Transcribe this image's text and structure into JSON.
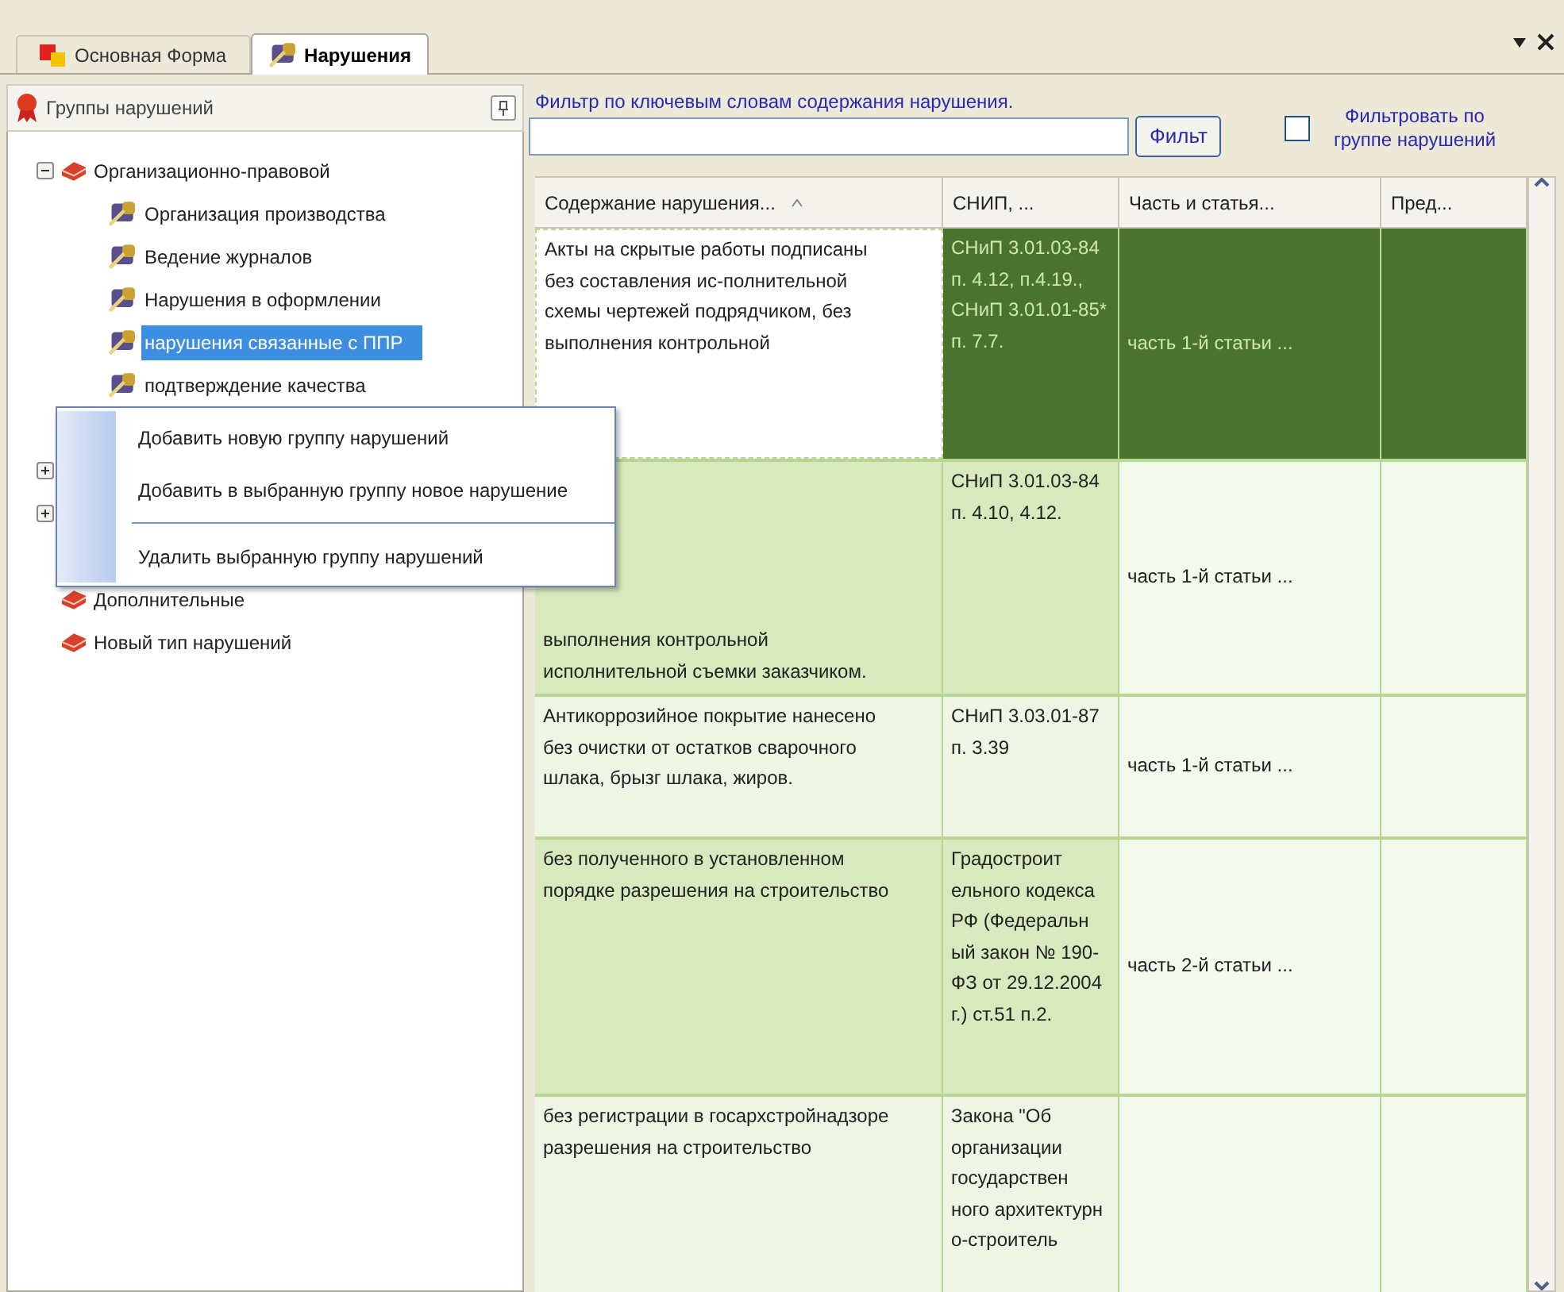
{
  "tabs": [
    {
      "label": "Основная Форма",
      "selected": false
    },
    {
      "label": "Нарушения",
      "selected": true
    }
  ],
  "groups_panel": {
    "title": "Группы нарушений",
    "tree": [
      {
        "label": "Организационно-правовой",
        "kind": "group",
        "expanded": true,
        "children": [
          {
            "label": "Организация производства",
            "kind": "leaf",
            "selected": false
          },
          {
            "label": "Ведение журналов",
            "kind": "leaf",
            "selected": false
          },
          {
            "label": "Нарушения в оформлении",
            "kind": "leaf",
            "selected": false
          },
          {
            "label": "нарушения связанные с ППР",
            "kind": "leaf",
            "selected": true
          },
          {
            "label": "подтверждение качества",
            "kind": "leaf",
            "selected": false
          }
        ]
      },
      {
        "kind": "group",
        "expanded": false
      },
      {
        "kind": "group",
        "expanded": false
      },
      {
        "label": "Дополнительные",
        "kind": "group"
      },
      {
        "label": "Новый тип нарушений",
        "kind": "group"
      }
    ]
  },
  "context_menu": [
    {
      "label": "Добавить новую группу нарушений"
    },
    {
      "label": "Добавить в выбранную группу новое нарушение"
    },
    {
      "kind": "separator"
    },
    {
      "label": "Удалить выбранную группу нарушений"
    }
  ],
  "filter": {
    "label": "Фильтр по ключевым словам содержания нарушения.",
    "button": "Фильт",
    "group_filter": {
      "label": "Фильтровать по группе нарушений",
      "checked": false
    }
  },
  "table": {
    "columns": [
      "Содержание нарушения...",
      "СНИП, ...",
      "Часть и статья...",
      "Пред..."
    ],
    "rows": [
      {
        "selected": true,
        "cells": [
          "Акты на скрытые работы подписаны без составления ис-полнительной схемы чертежей подрядчиком, без выполнения контрольной",
          "СНиП 3.01.03-84 п. 4.12, п.4.19., СНиП 3.01.01-85* п. 7.7.",
          "часть 1-й статьи ..."
        ]
      },
      {
        "selected": false,
        "cells": [
          "выполнения контрольной исполнительной съемки заказчиком.",
          "СНиП 3.01.03-84 п. 4.10, 4.12.",
          "часть 1-й статьи ..."
        ]
      },
      {
        "selected": false,
        "cells": [
          "Антикоррозийное покрытие нанесено без очистки от остатков сварочного шлака, брызг шлака, жиров.",
          "СНиП 3.03.01-87 п. 3.39",
          "часть 1-й статьи ..."
        ]
      },
      {
        "selected": false,
        "cells": [
          "без полученного в установленном порядке разрешения на строительство",
          "Градостроит ельного кодекса РФ (Федеральн ый закон № 190-ФЗ от 29.12.2004 г.) ст.51 п.2.",
          "часть 2-й статьи ..."
        ]
      },
      {
        "selected": false,
        "cells": [
          "без регистрации в госархстройнадзоре разрешения на строительство",
          "Закона \"Об организации государствен ного архитектурн о-строитель"
        ]
      }
    ]
  }
}
